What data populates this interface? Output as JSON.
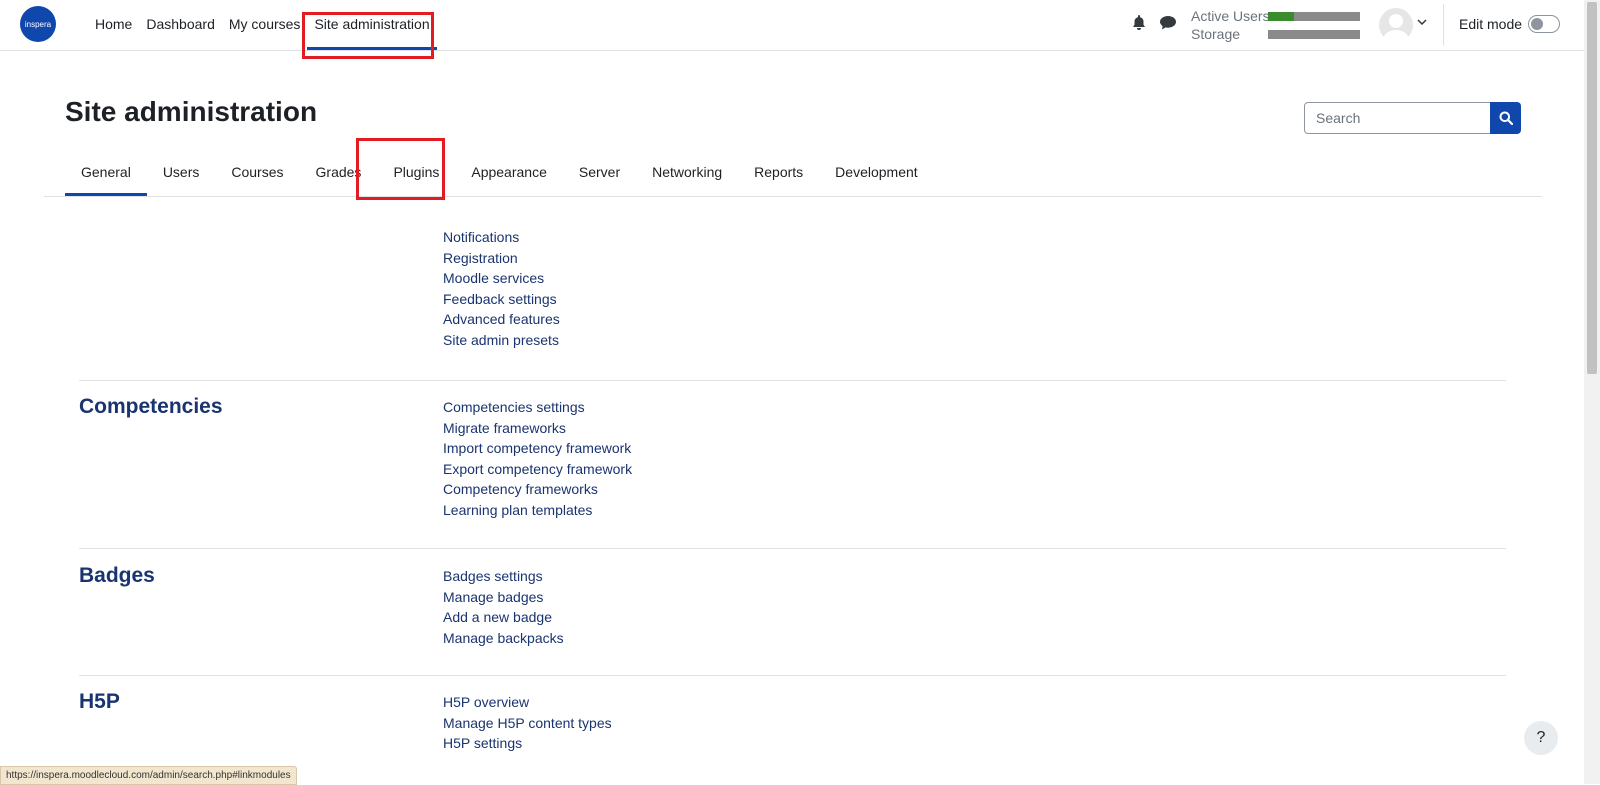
{
  "navbar": {
    "logo_text": "inspera",
    "primary_nav": [
      "Home",
      "Dashboard",
      "My courses",
      "Site administration"
    ],
    "active_nav": "Site administration",
    "usage": {
      "active_users_label": "Active Users",
      "storage_label": "Storage",
      "active_users_fraction": 0.28,
      "storage_fraction": 0.0,
      "fill_color": "#3a8b2b"
    },
    "edit_mode_label": "Edit mode",
    "edit_mode_on": false
  },
  "header": {
    "title": "Site administration",
    "search_placeholder": "Search"
  },
  "tabs": [
    "General",
    "Users",
    "Courses",
    "Grades",
    "Plugins",
    "Appearance",
    "Server",
    "Networking",
    "Reports",
    "Development"
  ],
  "active_tab": "General",
  "sections": [
    {
      "title": "",
      "links": [
        "Notifications",
        "Registration",
        "Moodle services",
        "Feedback settings",
        "Advanced features",
        "Site admin presets"
      ]
    },
    {
      "title": "Competencies",
      "links": [
        "Competencies settings",
        "Migrate frameworks",
        "Import competency framework",
        "Export competency framework",
        "Competency frameworks",
        "Learning plan templates"
      ]
    },
    {
      "title": "Badges",
      "links": [
        "Badges settings",
        "Manage badges",
        "Add a new badge",
        "Manage backpacks"
      ]
    },
    {
      "title": "H5P",
      "links": [
        "H5P overview",
        "Manage H5P content types",
        "H5P settings"
      ]
    }
  ],
  "status_url": "https://inspera.moodlecloud.com/admin/search.php#linkmodules",
  "help_label": "?",
  "colors": {
    "brand": "#0f47ad",
    "link": "#1a3470",
    "highlight_box": "#e31b23"
  }
}
